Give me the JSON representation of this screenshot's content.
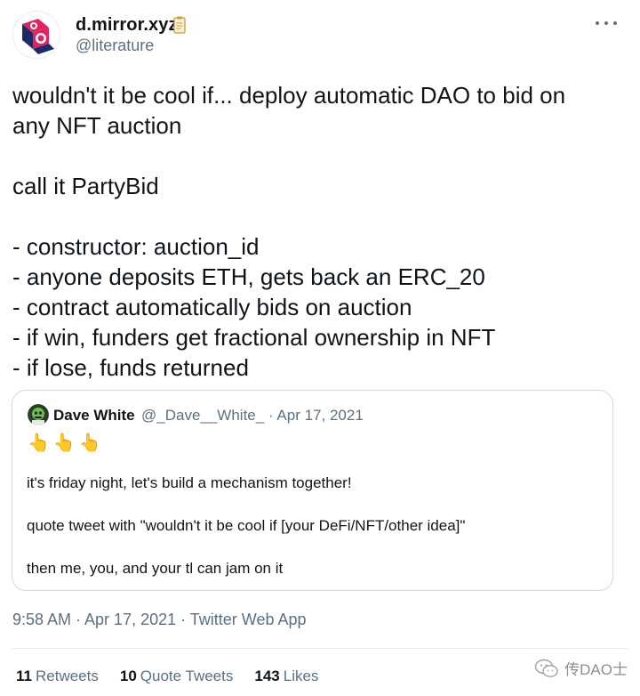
{
  "author": {
    "display_name": "d.mirror.xyz",
    "handle": "@literature",
    "badge_icon": "document-icon",
    "more_icon": "more-horizontal-icon"
  },
  "tweet": {
    "lines": [
      "wouldn't it be cool if... deploy automatic DAO to bid on",
      "any NFT auction",
      "",
      "call it PartyBid",
      "",
      "- constructor: auction_id",
      "- anyone deposits ETH, gets back an ERC_20",
      "- contract automatically bids on auction",
      "- if win, funders get fractional ownership in NFT",
      "- if lose, funds returned"
    ]
  },
  "quoted_tweet": {
    "display_name": "Dave White",
    "handle": "@_Dave__White_",
    "separator": "·",
    "date": "Apr 17, 2021",
    "emoji": "👆👆👆",
    "lines": [
      "it's friday night, let's build a mechanism together!",
      "quote tweet with \"wouldn't it be cool if [your DeFi/NFT/other idea]\"",
      "then me, you, and your tl can jam on it"
    ]
  },
  "meta": {
    "timestamp": "9:58 AM · Apr 17, 2021 · Twitter Web App"
  },
  "stats": {
    "retweets_count": "11",
    "retweets_label": "Retweets",
    "quotes_count": "10",
    "quotes_label": "Quote Tweets",
    "likes_count": "143",
    "likes_label": "Likes"
  },
  "watermark": {
    "text": "传DAO士",
    "icon": "wechat-icon"
  },
  "colors": {
    "text_primary": "#0f1419",
    "text_secondary": "#5b7083",
    "border": "#cfd9de",
    "avatar_red": "#e0245e",
    "avatar_navy": "#1c2a6b"
  }
}
